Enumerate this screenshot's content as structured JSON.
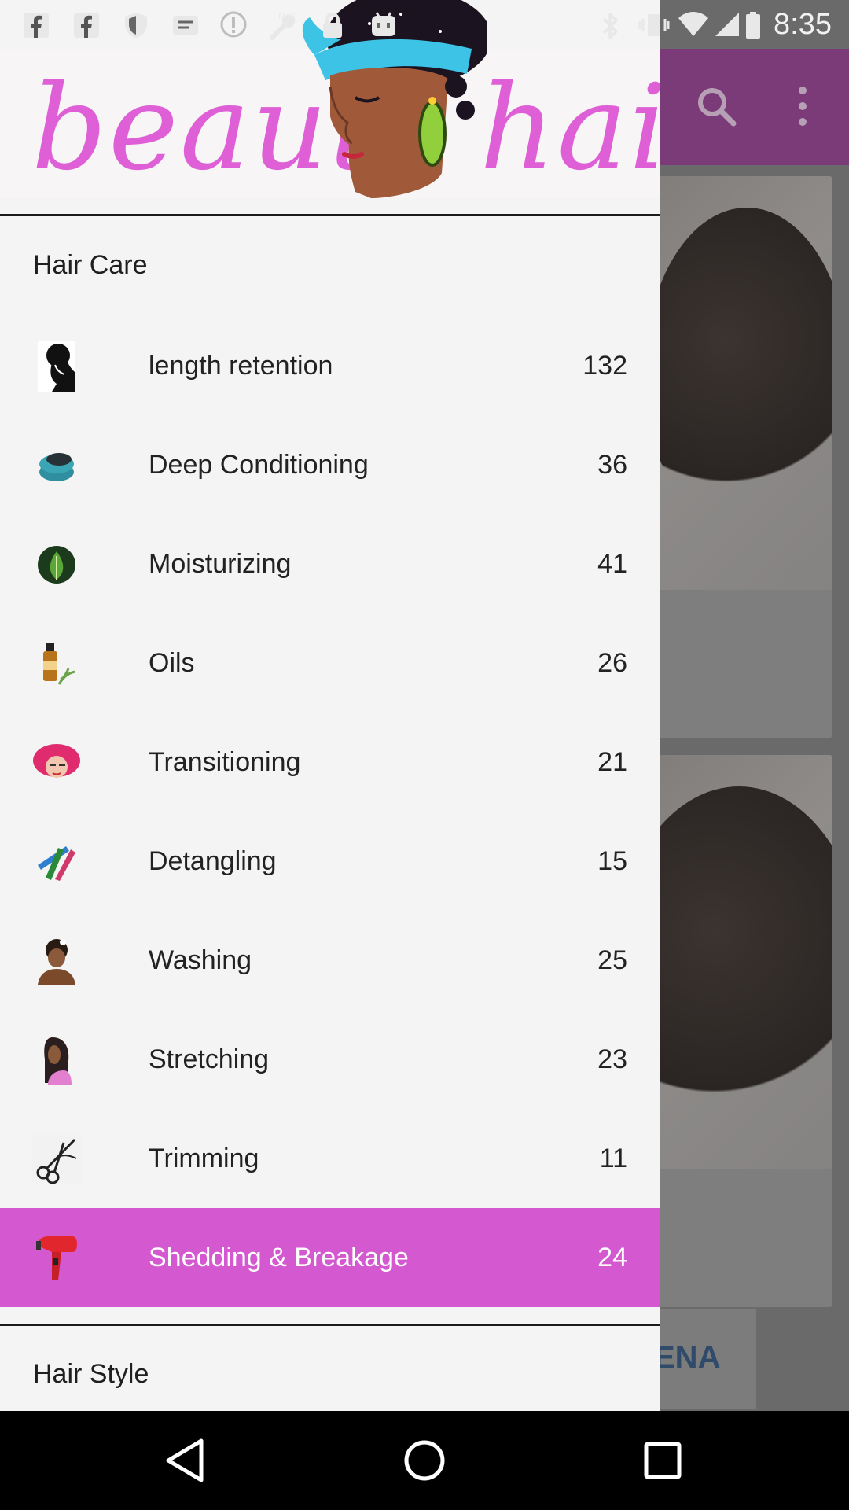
{
  "status_bar": {
    "time": "8:35",
    "left_icons": [
      "facebook-icon",
      "facebook-icon",
      "shield-icon",
      "message-icon",
      "info-icon",
      "fake-gps-icon",
      "lock-icon",
      "android-icon"
    ],
    "right_icons": [
      "bluetooth-icon",
      "vibrate-icon",
      "wifi-icon",
      "signal-icon",
      "battery-icon"
    ]
  },
  "drawer": {
    "logo": {
      "word_left": "beauty",
      "word_right": "hair",
      "color": "#de5fd6"
    },
    "section_hair_care": "Hair Care",
    "items": [
      {
        "label": "length retention",
        "count": "132",
        "icon": "silhouette-icon",
        "selected": false
      },
      {
        "label": "Deep Conditioning",
        "count": "36",
        "icon": "jar-icon",
        "selected": false
      },
      {
        "label": "Moisturizing",
        "count": "41",
        "icon": "aloe-icon",
        "selected": false
      },
      {
        "label": "Oils",
        "count": "26",
        "icon": "oil-bottle-icon",
        "selected": false
      },
      {
        "label": "Transitioning",
        "count": "21",
        "icon": "afro-icon",
        "selected": false
      },
      {
        "label": "Detangling",
        "count": "15",
        "icon": "combs-icon",
        "selected": false
      },
      {
        "label": "Washing",
        "count": "25",
        "icon": "woman-icon",
        "selected": false
      },
      {
        "label": "Stretching",
        "count": "23",
        "icon": "long-hair-icon",
        "selected": false
      },
      {
        "label": "Trimming",
        "count": "11",
        "icon": "scissors-icon",
        "selected": false
      },
      {
        "label": "Shedding & Breakage",
        "count": "24",
        "icon": "hair-dryer-icon",
        "selected": true
      }
    ],
    "section_hair_style": "Hair Style",
    "selected_color": "#d459d0"
  },
  "background_app": {
    "toolbar_color": "#7b3a78",
    "ad_text": "ENA"
  },
  "nav_bar": {
    "buttons": [
      "back-icon",
      "home-icon",
      "recents-icon"
    ]
  }
}
